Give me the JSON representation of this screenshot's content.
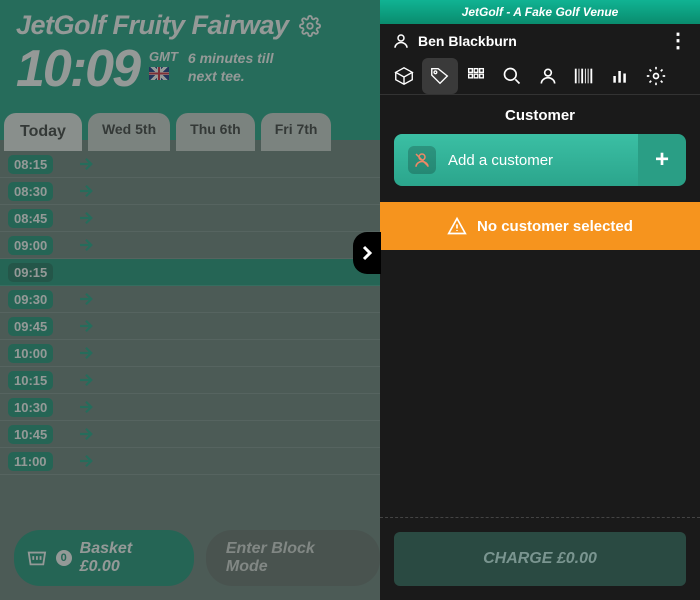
{
  "header": {
    "title": "JetGolf Fruity Fairway",
    "clock": "10:09",
    "tz": "GMT",
    "next_minutes": "6 minutes",
    "next_till": "till",
    "next_tee": "next tee."
  },
  "tabs": [
    "Today",
    "Wed 5th",
    "Thu 6th",
    "Fri 7th"
  ],
  "slots": [
    "08:15",
    "08:30",
    "08:45",
    "09:00",
    "09:15",
    "09:30",
    "09:45",
    "10:00",
    "10:15",
    "10:30",
    "10:45",
    "11:00"
  ],
  "highlight_slot": "09:15",
  "footer": {
    "basket_badge": "0",
    "basket_label": "Basket",
    "basket_amount": "£0.00",
    "block_label": "Enter Block Mode"
  },
  "panel": {
    "venue": "JetGolf - A Fake Golf Venue",
    "user": "Ben Blackburn",
    "section": "Customer",
    "add_label": "Add a customer",
    "warning": "No customer selected",
    "charge_label": "CHARGE",
    "charge_amount": "£0.00"
  }
}
